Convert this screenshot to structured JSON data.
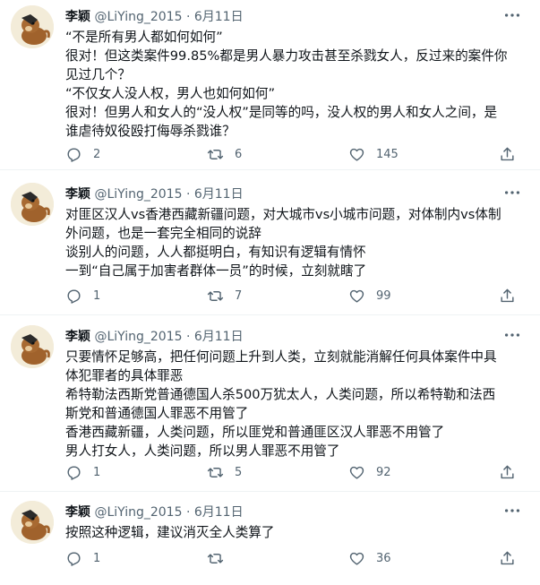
{
  "tweets": [
    {
      "author": {
        "name": "李颖",
        "handle": "@LiYing_2015",
        "sep": "·",
        "date": "6月11日"
      },
      "lines": [
        "“不是所有男人都如何如何”",
        "很对！但这类案件99.85%都是男人暴力攻击甚至杀戮女人，反过来的案件你",
        "见过几个？",
        "“不仅女人没人权，男人也如何如何”",
        "很对！但男人和女人的“没人权”是同等的吗，没人权的男人和女人之间，是",
        "谁虐待奴役殴打侮辱杀戮谁？"
      ],
      "stats": {
        "replies": "2",
        "retweets": "6",
        "likes": "145"
      }
    },
    {
      "author": {
        "name": "李颖",
        "handle": "@LiYing_2015",
        "sep": "·",
        "date": "6月11日"
      },
      "lines": [
        "对匪区汉人vs香港西藏新疆问题，对大城市vs小城市问题，对体制内vs体制",
        "外问题，也是一套完全相同的说辞",
        "谈别人的问题，人人都挺明白，有知识有逻辑有情怀",
        "一到“自己属于加害者群体一员”的时候，立刻就瞎了"
      ],
      "stats": {
        "replies": "1",
        "retweets": "7",
        "likes": "99"
      }
    },
    {
      "author": {
        "name": "李颖",
        "handle": "@LiYing_2015",
        "sep": "·",
        "date": "6月11日"
      },
      "lines": [
        "只要情怀足够高，把任何问题上升到人类，立刻就能消解任何具体案件中具",
        "体犯罪者的具体罪恶",
        "希特勒法西斯党普通德国人杀500万犹太人，人类问题，所以希特勒和法西",
        "斯党和普通德国人罪恶不用管了",
        "香港西藏新疆，人类问题，所以匪党和普通匪区汉人罪恶不用管了",
        "男人打女人，人类问题，所以男人罪恶不用管了"
      ],
      "stats": {
        "replies": "1",
        "retweets": "5",
        "likes": "92"
      }
    },
    {
      "author": {
        "name": "李颖",
        "handle": "@LiYing_2015",
        "sep": "·",
        "date": "6月11日"
      },
      "lines": [
        "按照这种逻辑，建议消灭全人类算了"
      ],
      "stats": {
        "replies": "1",
        "retweets": "",
        "likes": "36"
      }
    }
  ],
  "icons": {
    "reply": "reply-icon",
    "retweet": "retweet-icon",
    "like": "like-icon",
    "share": "share-icon",
    "more": "more-icon"
  },
  "colors": {
    "text": "#0f1419",
    "secondary": "#536471",
    "divider": "#eff3f4"
  }
}
